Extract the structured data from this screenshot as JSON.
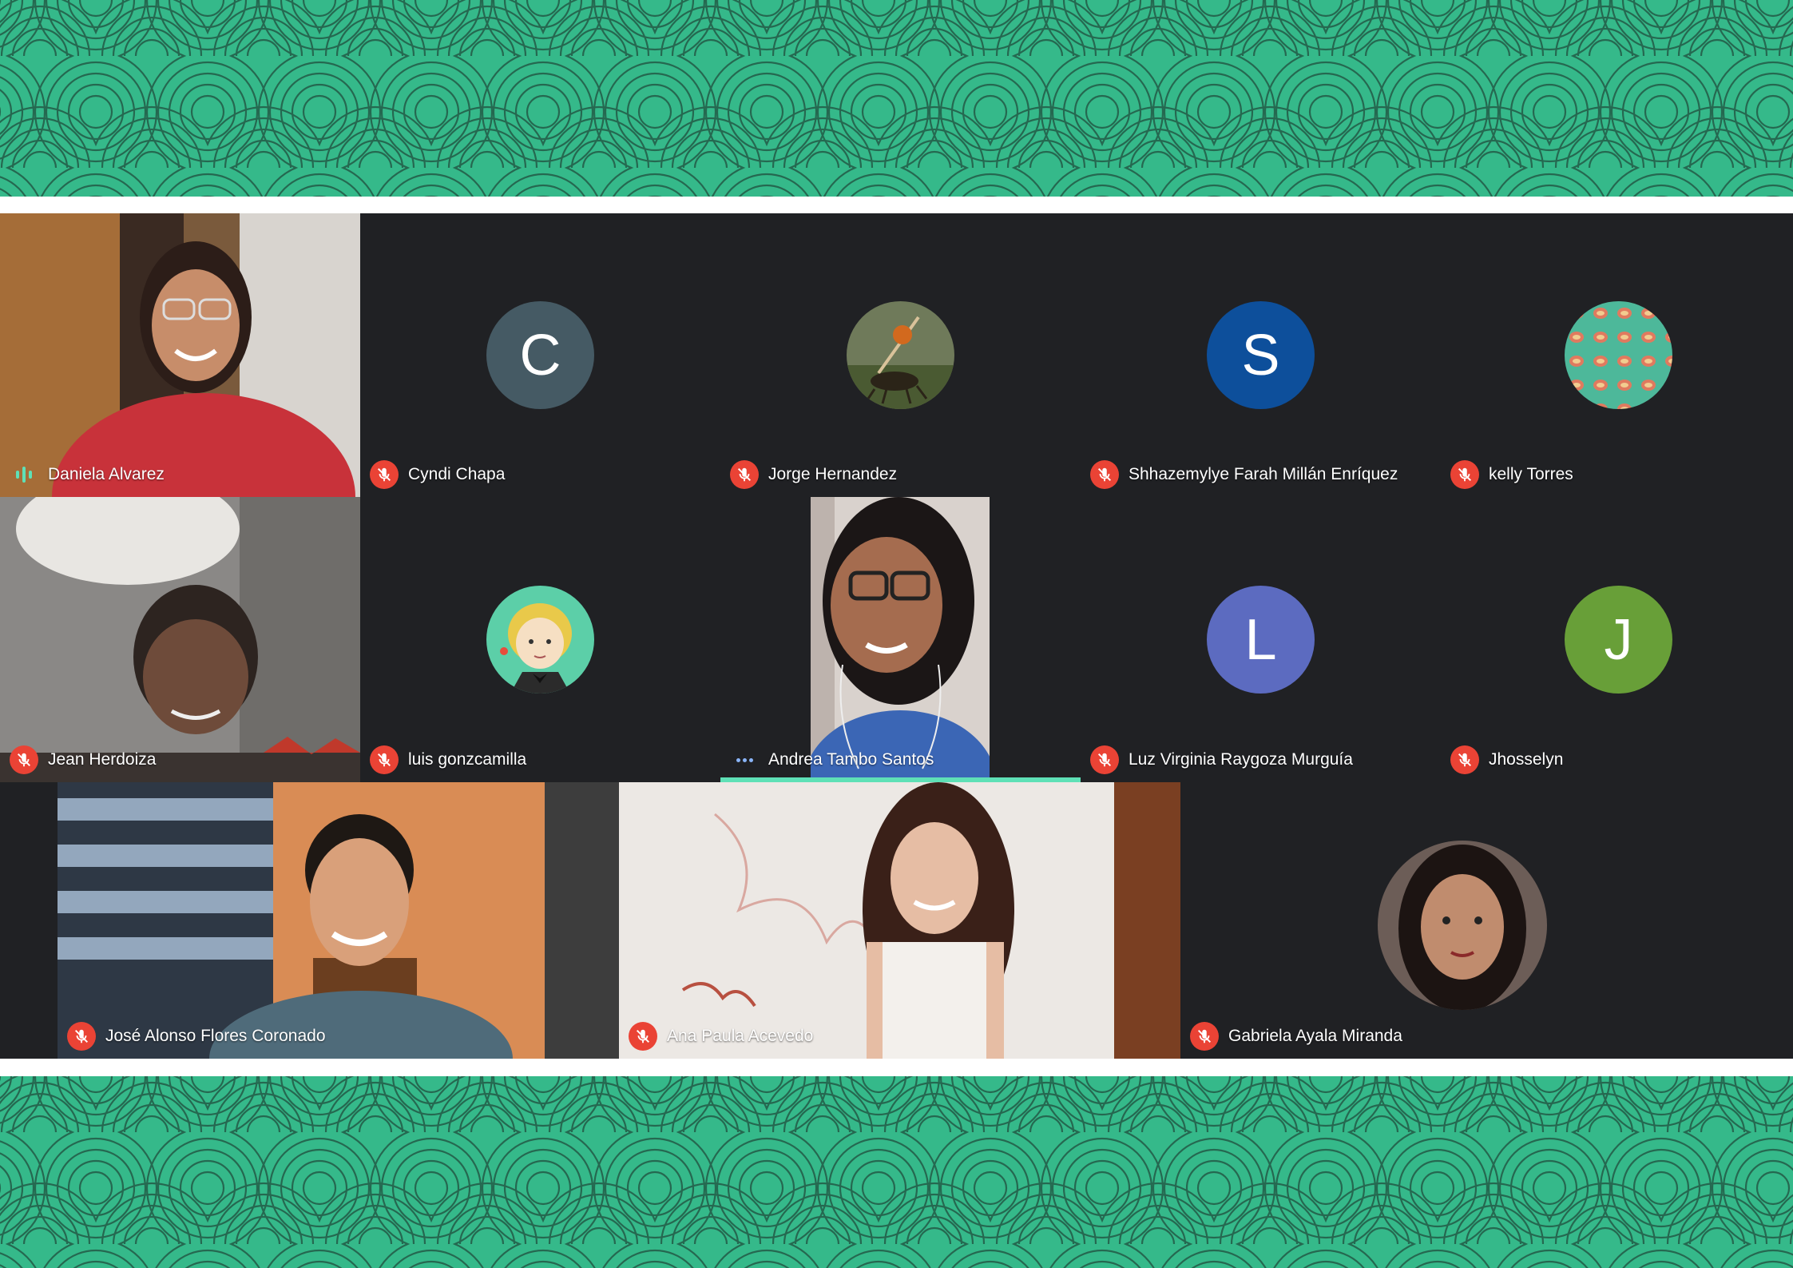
{
  "colors": {
    "banner_green": "#35b98a",
    "grid_background": "#202124",
    "muted_mic_red": "#ea4335",
    "active_speaker_teal": "#5ee0b6"
  },
  "participants": [
    {
      "name": "Daniela Alvarez",
      "status": "speaking",
      "view": "camera"
    },
    {
      "name": "Cyndi Chapa",
      "status": "muted",
      "avatar_letter": "C",
      "avatar_color": "#455a64"
    },
    {
      "name": "Jorge Hernandez",
      "status": "muted",
      "avatar_image": "ant-photo"
    },
    {
      "name": "Shhazemylye Farah Millán Enríquez",
      "status": "muted",
      "avatar_letter": "S",
      "avatar_color": "#0d4f9b"
    },
    {
      "name": "kelly Torres",
      "status": "muted",
      "avatar_image": "pattern"
    },
    {
      "name": "Jean Herdoiza",
      "status": "muted",
      "view": "camera"
    },
    {
      "name": "luis gonzcamilla",
      "status": "muted",
      "avatar_image": "cartoon"
    },
    {
      "name": "Andrea Tambo Santos",
      "status": "active",
      "view": "camera"
    },
    {
      "name": "Luz Virginia Raygoza Murguía",
      "status": "muted",
      "avatar_letter": "L",
      "avatar_color": "#5c6bc0"
    },
    {
      "name": "Jhosselyn",
      "status": "muted",
      "avatar_letter": "J",
      "avatar_color": "#689f38"
    },
    {
      "name": "José Alonso Flores Coronado",
      "status": "muted",
      "view": "camera"
    },
    {
      "name": "Ana Paula Acevedo",
      "status": "muted",
      "view": "camera"
    },
    {
      "name": "Gabriela Ayala Miranda",
      "status": "muted",
      "avatar_image": "photo"
    }
  ]
}
